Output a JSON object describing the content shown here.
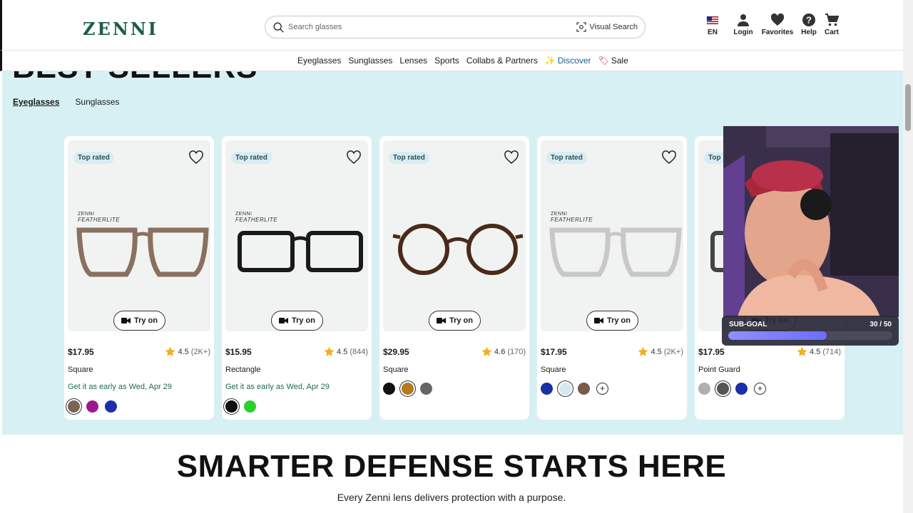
{
  "header": {
    "logo": "ZENNI",
    "search_placeholder": "Search glasses",
    "visual_search": "Visual Search",
    "utils": [
      {
        "label": "EN",
        "icon": "us-flag-icon"
      },
      {
        "label": "Login",
        "icon": "user-icon"
      },
      {
        "label": "Favorites",
        "icon": "heart-icon"
      },
      {
        "label": "Help",
        "icon": "help-icon"
      },
      {
        "label": "Cart",
        "icon": "cart-icon"
      }
    ]
  },
  "nav": {
    "items": [
      "Eyeglasses",
      "Sunglasses",
      "Lenses",
      "Sports",
      "Collabs & Partners"
    ],
    "discover": "Discover",
    "sale": "Sale"
  },
  "section": {
    "title": "BEST SELLERS",
    "tabs": [
      "Eyeglasses",
      "Sunglasses"
    ]
  },
  "products": [
    {
      "badge": "Top rated",
      "brand": "ZENNI",
      "sub": "FEATHERLITE",
      "price": "$17.95",
      "rating": "4.5",
      "count": "(2K+)",
      "shape": "Square",
      "ship": "Get it as early as Wed, Apr 29",
      "try": "Try on",
      "swatches": [
        "#7a6555",
        "#a0168c",
        "#1a2fa8"
      ],
      "frame_color": "#8a7060",
      "selected": 0
    },
    {
      "badge": "Top rated",
      "brand": "ZENNI",
      "sub": "FEATHERLITE",
      "price": "$15.95",
      "rating": "4.5",
      "count": "(844)",
      "shape": "Rectangle",
      "ship": "Get it as early as Wed, Apr 29",
      "try": "Try on",
      "swatches": [
        "#111111",
        "#2bd12b"
      ],
      "frame_color": "#1a1a1a",
      "selected": 0
    },
    {
      "badge": "Top rated",
      "brand": "",
      "sub": "",
      "price": "$29.95",
      "rating": "4.6",
      "count": "(170)",
      "shape": "Square",
      "ship": "",
      "try": "Try on",
      "swatches": [
        "#111111",
        "#b8781c",
        "#666666"
      ],
      "frame_color": "#4a2a18",
      "selected": 1
    },
    {
      "badge": "Top rated",
      "brand": "ZENNI",
      "sub": "FEATHERLITE",
      "price": "$17.95",
      "rating": "4.5",
      "count": "(2K+)",
      "shape": "Square",
      "ship": "",
      "try": "Try on",
      "swatches": [
        "#1a2fa8",
        "#d8e8f2",
        "#7a5a48"
      ],
      "frame_color": "#c8c8c8",
      "selected": 1,
      "plus": "+"
    },
    {
      "badge": "Top",
      "brand": "",
      "sub": "",
      "price": "$17.95",
      "rating": "4.5",
      "count": "(714)",
      "shape": "Point Guard",
      "ship": "",
      "try": "Try on",
      "swatches": [
        "#b0b0b0",
        "#555555",
        "#1a2fa8"
      ],
      "frame_color": "#444444",
      "selected": 1,
      "plus": "+"
    }
  ],
  "bottom": {
    "title": "SMARTER DEFENSE STARTS HERE",
    "subtitle": "Every Zenni lens delivers protection with a purpose."
  },
  "overlay": {
    "subgoal_label": "SUB-GOAL",
    "subgoal_value": "30 / 50",
    "subgoal_progress": 0.6
  }
}
